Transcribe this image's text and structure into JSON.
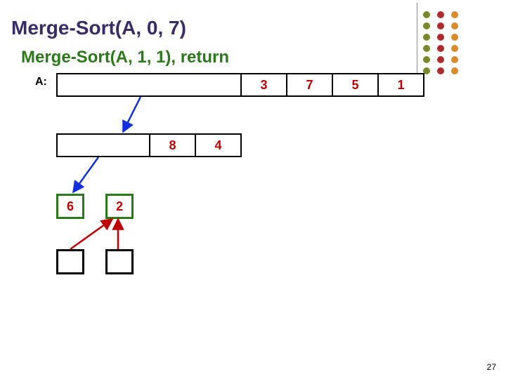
{
  "title": "Merge-Sort(A, 0, 7)",
  "subtitle": "Merge-Sort(A, 1, 1), return",
  "a_label": "A:",
  "page_number": "27",
  "row_top": {
    "cells": [
      "",
      "",
      "",
      "",
      "3",
      "7",
      "5",
      "1"
    ]
  },
  "row_mid": {
    "cells": [
      "",
      "",
      "8",
      "4"
    ]
  },
  "row_hl": {
    "left": "6",
    "right": "2"
  },
  "dot_colors": {
    "col1": "#7a8a2a",
    "col2": "#b02a2a",
    "col3": "#d98a2a"
  }
}
